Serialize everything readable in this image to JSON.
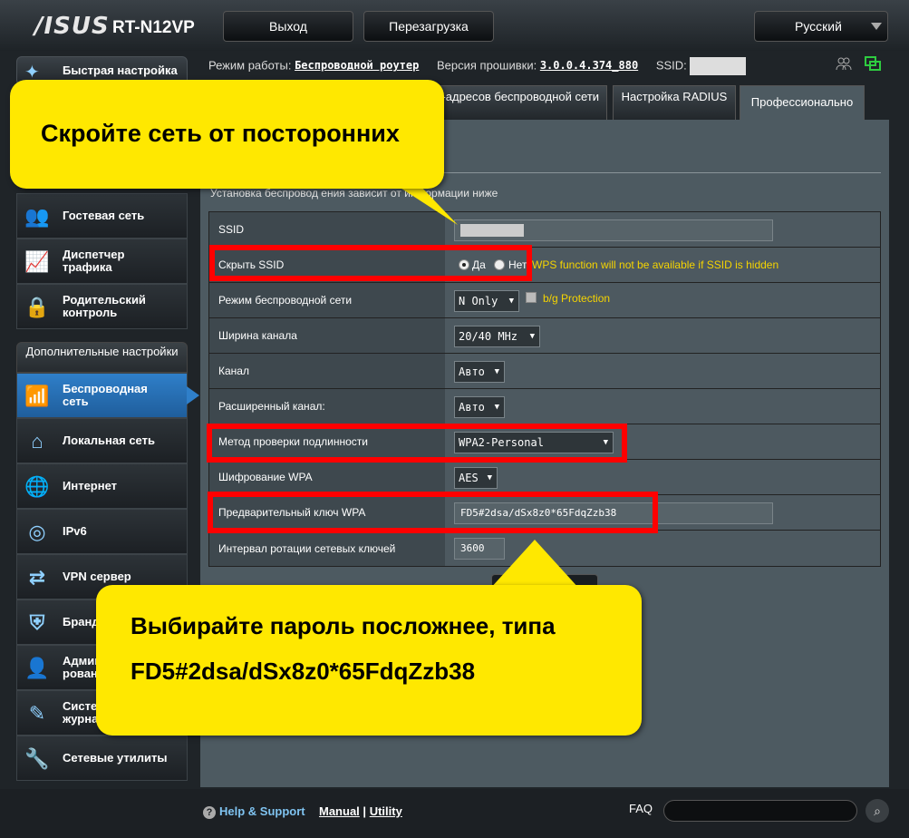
{
  "header": {
    "logo": "/ISUS",
    "model": "RT-N12VP",
    "logout_label": "Выход",
    "reboot_label": "Перезагрузка",
    "language": "Русский"
  },
  "status": {
    "mode_label": "Режим работы:",
    "mode_value": "Беспроводной роутер",
    "firmware_label": "Версия прошивки:",
    "firmware_value": "3.0.0.4.374_880",
    "ssid_label": "SSID:"
  },
  "sidebar": {
    "quick_setup": "Быстрая настройка",
    "items_top": [
      {
        "label": "Гостевая сеть",
        "icon": "guest-network-icon"
      },
      {
        "label": "Диспетчер трафика",
        "icon": "traffic-manager-icon"
      },
      {
        "label": "Родительский контроль",
        "icon": "parental-control-icon"
      }
    ],
    "advanced_header": "Дополнительные настройки",
    "items_adv": [
      {
        "label": "Беспроводная сеть",
        "icon": "wireless-icon"
      },
      {
        "label": "Локальная сеть",
        "icon": "lan-home-icon"
      },
      {
        "label": "Интернет",
        "icon": "globe-icon"
      },
      {
        "label": "IPv6",
        "icon": "ipv6-icon"
      },
      {
        "label": "VPN сервер",
        "icon": "vpn-icon"
      },
      {
        "label": "Бранд",
        "icon": "firewall-shield-icon"
      },
      {
        "label": "Админ рован",
        "icon": "admin-user-icon"
      },
      {
        "label": "Систе журна",
        "icon": "system-log-icon"
      },
      {
        "label": "Сетевые утилиты",
        "icon": "network-tools-icon"
      }
    ]
  },
  "tabs": [
    {
      "label": "с-адресов беспроводной сети"
    },
    {
      "label": "Настройка RADIUS"
    },
    {
      "label": "Профессионально"
    }
  ],
  "form": {
    "description": "Установка беспровод                  ения зависит от информации ниже",
    "ssid_label": "SSID",
    "hide_ssid_label": "Скрыть SSID",
    "hide_yes": "Да",
    "hide_no": "Нет",
    "hide_hint": "WPS function will not be available if SSID is hidden",
    "wireless_mode_label": "Режим беспроводной сети",
    "wireless_mode_value": "N Only",
    "bg_protection": "b/g Protection",
    "channel_width_label": "Ширина канала",
    "channel_width_value": "20/40 MHz",
    "channel_label": "Канал",
    "channel_value": "Авто",
    "ext_channel_label": "Расширенный канал:",
    "ext_channel_value": "Авто",
    "auth_label": "Метод проверки подлинности",
    "auth_value": "WPA2-Personal",
    "wpa_enc_label": "Шифрование WPA",
    "wpa_enc_value": "AES",
    "psk_label": "Предварительный ключ WPA",
    "psk_value": "FD5#2dsa/dSx8z0*65FdqZzb38",
    "rotation_label": "Интервал ротации сетевых ключей",
    "rotation_value": "3600"
  },
  "callouts": {
    "top": "Скройте сеть от посторонних",
    "bottom_line1": "Выбирайте пароль посложнее, типа",
    "bottom_line2": "FD5#2dsa/dSx8z0*65FdqZzb38"
  },
  "footer": {
    "help": "Help & Support",
    "manual": "Manual",
    "separator": "|",
    "utility": "Utility",
    "faq": "FAQ"
  },
  "colors": {
    "accent": "#2f7fc9",
    "highlight": "#ff0000",
    "callout": "#ffe800",
    "hint": "#f5d400"
  }
}
